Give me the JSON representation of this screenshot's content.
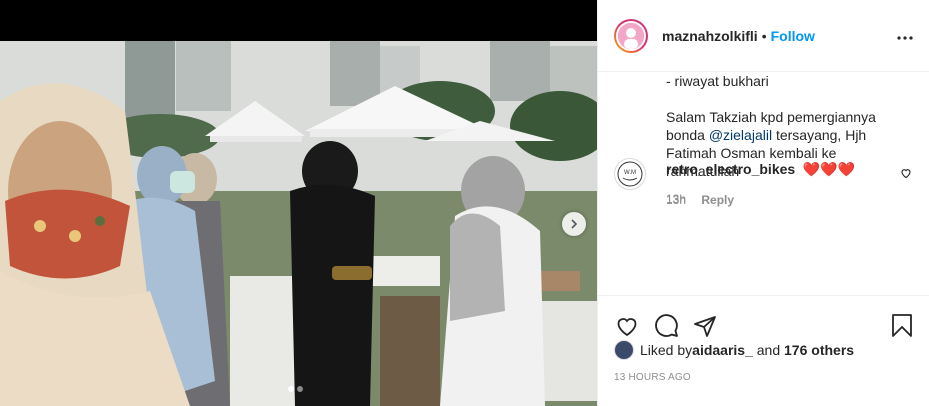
{
  "post": {
    "username": "maznahzolkifli",
    "separator": "•",
    "follow_label": "Follow",
    "more_icon": "more-horizontal-icon",
    "caption": "- riwayat bukhari\n\nSalam Takziah kpd pemergiannya bonda ",
    "caption_mention": "@zielajalil",
    "caption_rest": " tersayang, Hjh Fatimah Osman kembali ke rahmatullah",
    "caption_time": "13h"
  },
  "comment": {
    "username": "retro_electro_bikes",
    "text": "❤️❤️❤️",
    "time": "13h",
    "reply_label": "Reply",
    "like_icon": "heart-outline-icon",
    "avatar_text": "W.M"
  },
  "actions": {
    "like_icon": "heart-outline-icon",
    "comment_icon": "comment-bubble-icon",
    "share_icon": "paper-plane-icon",
    "save_icon": "bookmark-icon"
  },
  "likes": {
    "prefix": "Liked by ",
    "user": "aidaaris_",
    "middle": " and ",
    "others": "176 others"
  },
  "date": "13 HOURS AGO",
  "carousel": {
    "current": 1,
    "total": 2
  },
  "colors": {
    "accent": "#0095f6",
    "text": "#262626",
    "muted": "#8e8e8e",
    "heart": "#ed4956"
  }
}
